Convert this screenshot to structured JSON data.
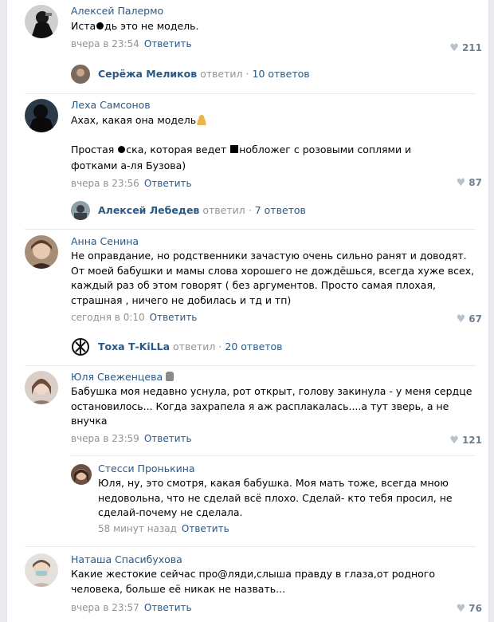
{
  "comments": [
    {
      "author": "Алексей Палермо",
      "text_lines": [
        "Иста",
        "дь это не модель."
      ],
      "time": "вчера в 23:54",
      "reply_label": "Ответить",
      "likes": "211",
      "thread": {
        "name": "Серёжа Меликов",
        "verb": "ответил",
        "count": "10 ответов"
      }
    },
    {
      "author": "Леха Самсонов",
      "text_lines": [
        "Ахах, какая она модель",
        "Простая ",
        "ска, которая ведет ",
        "нобложег с розовыми соплями и",
        "фотками а-ля Бузова)"
      ],
      "time": "вчера в 23:56",
      "reply_label": "Ответить",
      "likes": "87",
      "thread": {
        "name": "Алексей Лебедев",
        "verb": "ответил",
        "count": "7 ответов"
      }
    },
    {
      "author": "Анна Сенина",
      "text_lines": [
        "Не оправдание, но родственники зачастую очень сильно ранят и доводят.",
        "От моей бабушки и мамы слова хорошего не дождёшься, всегда хуже всех,",
        "каждый раз об этом говорят ( без аргументов. Просто самая плохая,",
        "страшная , ничего не добилась и тд и тп)"
      ],
      "time": "сегодня в 0:10",
      "reply_label": "Ответить",
      "likes": "67",
      "thread": {
        "name": "Тоха Т-KiLLa",
        "verb": "ответил",
        "count": "20 ответов"
      }
    },
    {
      "author": "Юля Свеженцева",
      "text_lines": [
        "Бабушка моя недавно уснула, рот открыт, голову закинула - у меня сердце",
        "остановилось... Когда захрапела я аж расплакалась....а тут зверь, а не",
        "внучка"
      ],
      "time": "вчера в 23:59",
      "reply_label": "Ответить",
      "likes": "121"
    },
    {
      "author": "Стесси Пронькина",
      "text_lines": [
        "Юля, ну, это смотря, какая бабушка. Моя мать тоже, всегда мною",
        "недовольна, что не сделай всё плохо. Сделай- кто тебя просил, не",
        "сделай-почему не сделала."
      ],
      "time": "58 минут назад",
      "reply_label": "Ответить"
    },
    {
      "author": "Наташа Спасибухова",
      "text_lines": [
        "Какие жестокие сейчас про@ляди,слыша правду в глаза,от родного",
        "человека, больше её никак не назвать..."
      ],
      "time": "вчера в 23:57",
      "reply_label": "Ответить",
      "likes": "76"
    }
  ],
  "colors": {
    "link": "#2a5885",
    "meta": "#939393",
    "likes": "#6f7f92",
    "separator": "#e7e8ec",
    "background": "#e8eaee"
  }
}
